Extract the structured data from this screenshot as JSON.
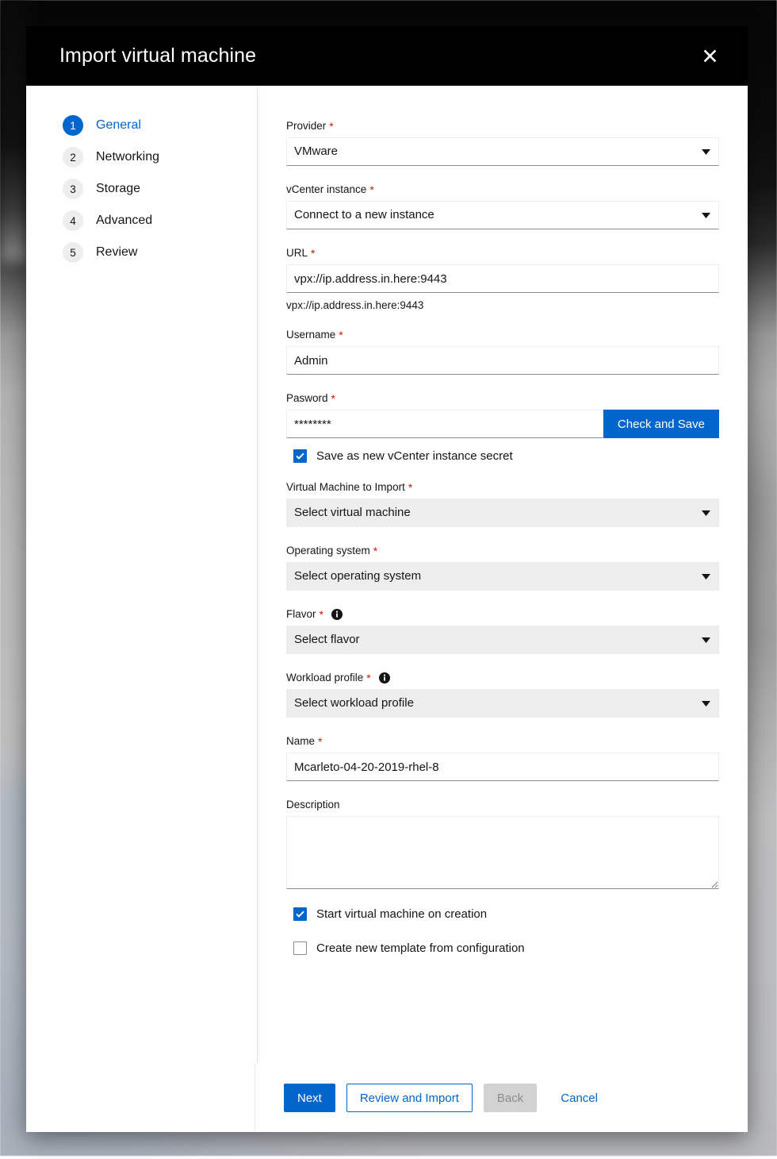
{
  "modal": {
    "title": "Import virtual machine",
    "close_label": "Close",
    "close_icon": "close-icon"
  },
  "wizard": {
    "steps": [
      {
        "number": "1",
        "label": "General",
        "active": true
      },
      {
        "number": "2",
        "label": "Networking",
        "active": false
      },
      {
        "number": "3",
        "label": "Storage",
        "active": false
      },
      {
        "number": "4",
        "label": "Advanced",
        "active": false
      },
      {
        "number": "5",
        "label": "Review",
        "active": false
      }
    ]
  },
  "form": {
    "provider": {
      "label": "Provider",
      "required": "*",
      "value": "VMware",
      "icon": "chevron-down-icon"
    },
    "vcenter_instance": {
      "label": "vCenter instance",
      "required": "*",
      "value": "Connect to a new instance",
      "icon": "chevron-down-icon"
    },
    "url": {
      "label": "URL",
      "required": "*",
      "value": "vpx://ip.address.in.here:9443",
      "helper": "vpx://ip.address.in.here:9443"
    },
    "username": {
      "label": "Username",
      "required": "*",
      "value": "Admin"
    },
    "password": {
      "label": "Pasword",
      "required": "*",
      "value": "********",
      "button_label": "Check and Save"
    },
    "save_secret": {
      "label": "Save as new vCenter instance secret",
      "checked": true
    },
    "vm_to_import": {
      "label": "Virtual Machine to Import",
      "required": "*",
      "value": "Select virtual machine",
      "disabled": true,
      "icon": "chevron-down-icon"
    },
    "operating_system": {
      "label": "Operating system",
      "required": "*",
      "value": "Select operating system",
      "disabled": true,
      "icon": "chevron-down-icon"
    },
    "flavor": {
      "label": "Flavor",
      "required": "*",
      "info_icon": "info-icon",
      "value": "Select flavor",
      "disabled": true,
      "icon": "chevron-down-icon"
    },
    "workload_profile": {
      "label": "Workload profile",
      "required": "*",
      "info_icon": "info-icon",
      "value": "Select workload profile",
      "disabled": true,
      "icon": "chevron-down-icon"
    },
    "name": {
      "label": "Name",
      "required": "*",
      "value": "Mcarleto-04-20-2019-rhel-8"
    },
    "description": {
      "label": "Description",
      "value": "",
      "placeholder": ""
    },
    "start_vm": {
      "label": "Start virtual machine on creation",
      "checked": true
    },
    "create_template": {
      "label": "Create new template from configuration",
      "checked": false
    }
  },
  "footer": {
    "next_label": "Next",
    "review_label": "Review and Import",
    "back_label": "Back",
    "cancel_label": "Cancel"
  },
  "colors": {
    "accent": "#0066CC",
    "required": "#C9190B",
    "header_bg": "#000000",
    "disabled_bg": "#EDEDED",
    "disabled_text": "#8A8D90"
  }
}
